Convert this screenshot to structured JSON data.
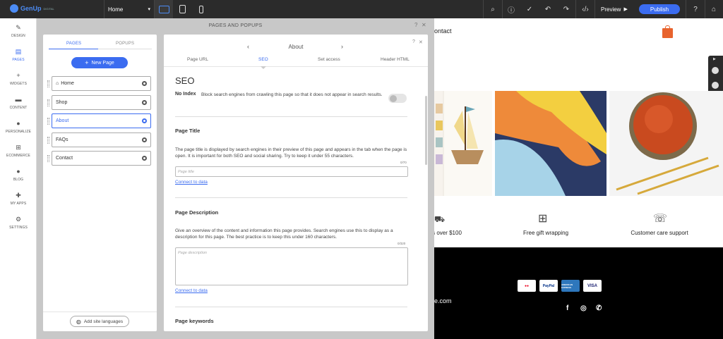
{
  "topbar": {
    "logo": "GenUp",
    "logo_sub": "DIGITAL",
    "page_select": "Home",
    "preview_label": "Preview",
    "publish_label": "Publish"
  },
  "leftnav": [
    {
      "label": "DESIGN",
      "icon": "brush-icon"
    },
    {
      "label": "PAGES",
      "icon": "pages-icon",
      "active": true
    },
    {
      "label": "WIDGETS",
      "icon": "plus-icon"
    },
    {
      "label": "CONTENT",
      "icon": "folder-icon"
    },
    {
      "label": "PERSONALIZE",
      "icon": "person-icon"
    },
    {
      "label": "ECOMMERCE",
      "icon": "cart-icon"
    },
    {
      "label": "BLOG",
      "icon": "chat-bubble-icon"
    },
    {
      "label": "MY APPS",
      "icon": "puzzle-icon"
    },
    {
      "label": "SETTINGS",
      "icon": "gear-icon"
    }
  ],
  "workspace": {
    "title": "PAGES AND POPUPS"
  },
  "pages_panel": {
    "tabs": [
      "PAGES",
      "POPUPS"
    ],
    "new_page": "New Page",
    "pages": [
      "Home",
      "Shop",
      "About",
      "FAQs",
      "Contact"
    ],
    "selected_page": "About",
    "add_languages": "Add site languages"
  },
  "seo_panel": {
    "current_page": "About",
    "tabs": [
      "Page URL",
      "SEO",
      "Set access",
      "Header HTML"
    ],
    "heading": "SEO",
    "noindex_title": "No Index",
    "noindex_desc": "Block search engines from crawling this page so that it does not appear in search results.",
    "page_title": {
      "title": "Page Title",
      "desc": "The page title is displayed by search engines in their preview of this page and appears in the tab when the page is open. It is important for both SEO and social sharing. Try to keep it under 55 characters.",
      "counter": "0/70",
      "placeholder": "Page title",
      "link": "Connect to data"
    },
    "page_desc": {
      "title": "Page Description",
      "desc": "Give an overview of the content and information this page provides. Search engines use this to display as a description for this page. The best practice is to keep this under 160 characters.",
      "counter": "0/320",
      "placeholder": "Page description",
      "link": "Connect to data"
    },
    "page_keywords": {
      "title": "Page keywords"
    }
  },
  "canvas": {
    "contact_partial": "ontact",
    "features": [
      "s over $100",
      "Free gift wrapping",
      "Customer care support"
    ],
    "payment_cards": [
      "mastercard",
      "PayPal",
      "AMERICAN EXPRESS",
      "VISA"
    ],
    "domain_partial": "e.com"
  },
  "colors": {
    "accent": "#3b6cf0",
    "topbar": "#2b2b2b",
    "workspace": "#c8c8c8"
  }
}
